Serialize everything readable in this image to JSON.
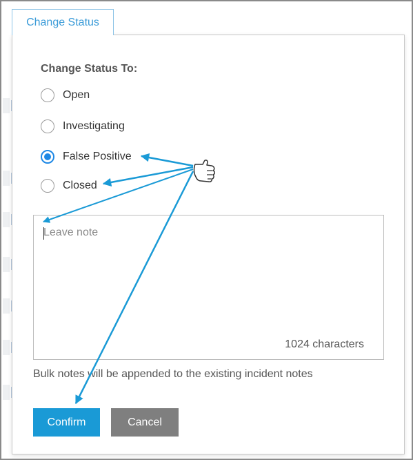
{
  "trigger": {
    "label": "Change Status"
  },
  "form": {
    "heading": "Change Status To:",
    "options": [
      {
        "label": "Open",
        "checked": false
      },
      {
        "label": "Investigating",
        "checked": false
      },
      {
        "label": "False Positive",
        "checked": true
      },
      {
        "label": "Closed",
        "checked": false
      }
    ],
    "note": {
      "placeholder": "Leave note",
      "value": ""
    },
    "char_counter": "1024 characters",
    "hint": "Bulk notes will be appended to the existing incident notes",
    "confirm_label": "Confirm",
    "cancel_label": "Cancel"
  },
  "annotation": {
    "arrow_color": "#1a9ad6",
    "icon": "pointing-hand-cursor-icon"
  }
}
